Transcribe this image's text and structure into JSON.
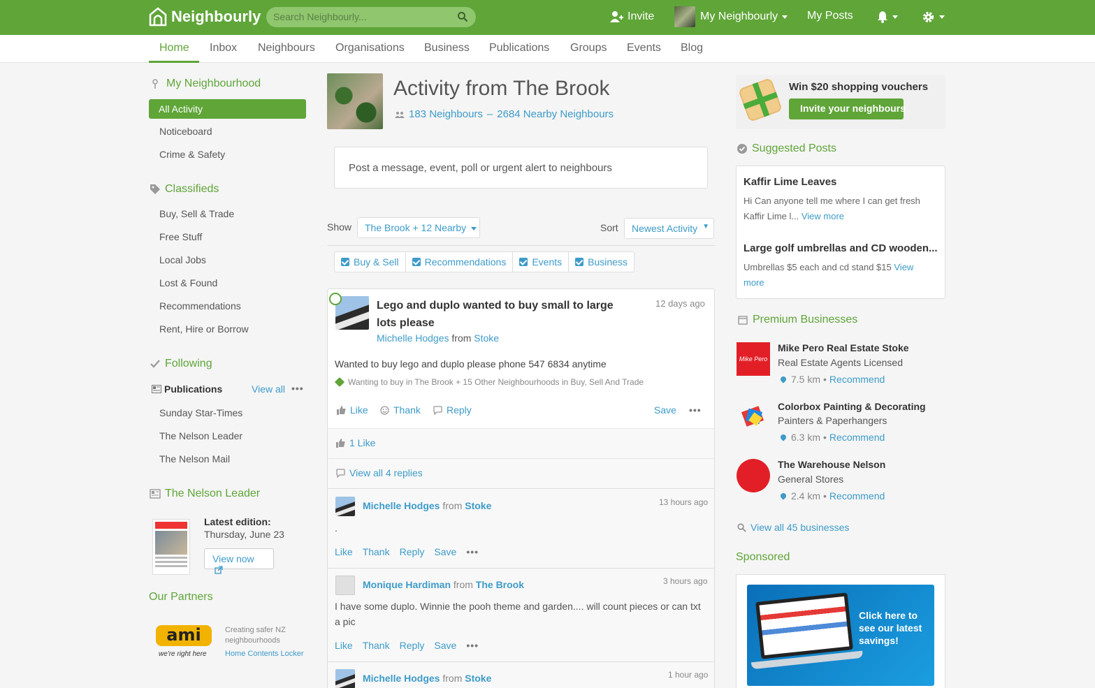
{
  "app": {
    "name": "Neighbourly"
  },
  "topbar": {
    "search_placeholder": "Search Neighbourly...",
    "invite": "Invite",
    "my_neighbourly": "My Neighbourly",
    "my_posts": "My Posts"
  },
  "colors": {
    "brand": "#5fa538",
    "link": "#3d9bc9"
  },
  "subnav": [
    "Home",
    "Inbox",
    "Neighbours",
    "Organisations",
    "Business",
    "Publications",
    "Groups",
    "Events",
    "Blog"
  ],
  "sidebar": {
    "my_neighbourhood": "My Neighbourhood",
    "all_activity": "All Activity",
    "noticeboard": "Noticeboard",
    "crime_safety": "Crime & Safety",
    "classifieds": "Classifieds",
    "classified_items": [
      "Buy, Sell & Trade",
      "Free Stuff",
      "Local Jobs",
      "Lost & Found",
      "Recommendations",
      "Rent, Hire or Borrow"
    ],
    "following": "Following",
    "publications": "Publications",
    "view_all": "View all",
    "publication_items": [
      "Sunday Star-Times",
      "The Nelson Leader",
      "The Nelson Mail"
    ],
    "nelson_leader": "The Nelson Leader",
    "latest_edition_label": "Latest edition:",
    "latest_edition_date": "Thursday, June 23",
    "view_now": "View now",
    "our_partners": "Our Partners",
    "partner_text": "Creating safer NZ neighbourhoods",
    "partner_link": "Home Contents Locker",
    "partner_logo": "ami",
    "partner_tagline": "we're right here"
  },
  "main": {
    "title": "Activity from The Brook",
    "neighbours": "183 Neighbours",
    "separator": "–",
    "nearby": "2684 Nearby Neighbours",
    "post_placeholder": "Post a message, event, poll or urgent alert to neighbours",
    "show_label": "Show",
    "show_value": "The Brook + 12 Nearby",
    "sort_label": "Sort",
    "sort_value": "Newest Activity",
    "filters": [
      "Buy & Sell",
      "Recommendations",
      "Events",
      "Business"
    ],
    "post": {
      "title": "Lego and duplo wanted to buy small to large lots please",
      "time": "12 days ago",
      "author": "Michelle Hodges",
      "from": "from",
      "location": "Stoke",
      "body": "Wanted to buy lego and duplo please phone 547 6834 anytime",
      "category": "Wanting to buy in The Brook + 15 Other Neighbourhoods in Buy, Sell And Trade",
      "like": "Like",
      "thank": "Thank",
      "reply": "Reply",
      "save": "Save",
      "likes_count": "1 Like",
      "view_replies": "View all 4 replies"
    },
    "replies": [
      {
        "author": "Michelle Hodges",
        "from": "from",
        "location": "Stoke",
        "time": "13 hours ago",
        "body": "."
      },
      {
        "author": "Monique Hardiman",
        "from": "from",
        "location": "The Brook",
        "time": "3 hours ago",
        "body": "I have some duplo. Winnie the pooh theme and garden.... will count pieces or can txt a pic"
      },
      {
        "author": "Michelle Hodges",
        "from": "from",
        "location": "Stoke",
        "time": "1 hour ago"
      }
    ],
    "reply_actions": [
      "Like",
      "Thank",
      "Reply",
      "Save"
    ]
  },
  "right": {
    "promo_title": "Win $20 shopping vouchers",
    "promo_button": "Invite your neighbours",
    "suggested_posts": "Suggested Posts",
    "suggestions": [
      {
        "title": "Kaffir Lime Leaves",
        "body": "Hi Can anyone tell me where I can get fresh Kaffir Lime l...",
        "more": "View more"
      },
      {
        "title": "Large golf umbrellas and CD wooden...",
        "body": "Umbrellas $5 each and cd stand $15",
        "more": "View more"
      }
    ],
    "premium_businesses": "Premium Businesses",
    "businesses": [
      {
        "name": "Mike Pero Real Estate Stoke",
        "category": "Real Estate Agents Licensed",
        "distance": "7.5 km",
        "action": "Recommend",
        "logo_text": "Mike Pero"
      },
      {
        "name": "Colorbox Painting & Decorating",
        "category": "Painters & Paperhangers",
        "distance": "6.3 km",
        "action": "Recommend"
      },
      {
        "name": "The Warehouse Nelson",
        "category": "General Stores",
        "distance": "2.4 km",
        "action": "Recommend"
      }
    ],
    "view_all_businesses": "View all 45 businesses",
    "sponsored": "Sponsored",
    "ad_text": "Click here to see our latest savings!"
  }
}
